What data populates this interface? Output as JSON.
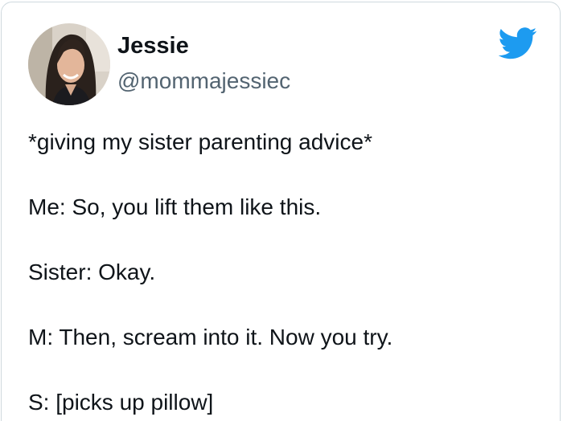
{
  "user": {
    "display_name": "Jessie",
    "handle": "@mommajessiec"
  },
  "icons": {
    "brand": "twitter-bird-icon",
    "brand_color": "#1d9bf0"
  },
  "tweet": {
    "lines": [
      "*giving my sister parenting advice*",
      "Me: So, you lift them like this.",
      "Sister: Okay.",
      "M: Then, scream into it. Now you try.",
      "S: [picks up pillow]"
    ]
  }
}
